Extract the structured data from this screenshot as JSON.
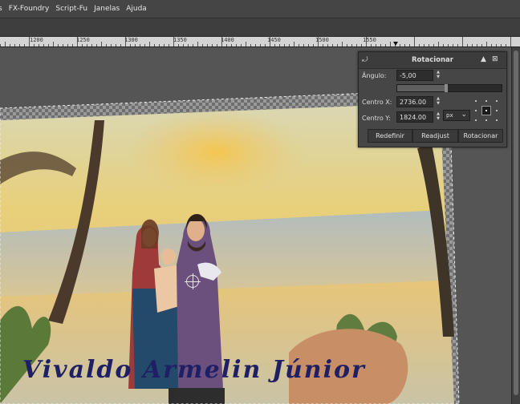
{
  "menubar": {
    "items": [
      "s",
      "FX-Foundry",
      "Script-Fu",
      "Janelas",
      "Ajuda"
    ]
  },
  "ruler": {
    "labels": [
      "1200",
      "1250",
      "1300",
      "1350",
      "1400",
      "1450",
      "1500",
      "1550"
    ]
  },
  "rotate_dialog": {
    "title": "Rotacionar",
    "angle_label": "Ângulo:",
    "angle_value": "-5,00",
    "center_x_label": "Centro X:",
    "center_x_value": "2736.00",
    "center_y_label": "Centro Y:",
    "center_y_value": "1824.00",
    "unit": "px",
    "buttons": {
      "reset": "Redefinir",
      "readjust": "Readjust",
      "rotate": "Rotacionar"
    }
  },
  "watermark": "Vivaldo Armelin Júnior",
  "colors": {
    "panel_bg": "#464646",
    "menubar_bg": "#454545",
    "ruler_bg": "#d4d4d4",
    "watermark": "#1f1f66"
  }
}
